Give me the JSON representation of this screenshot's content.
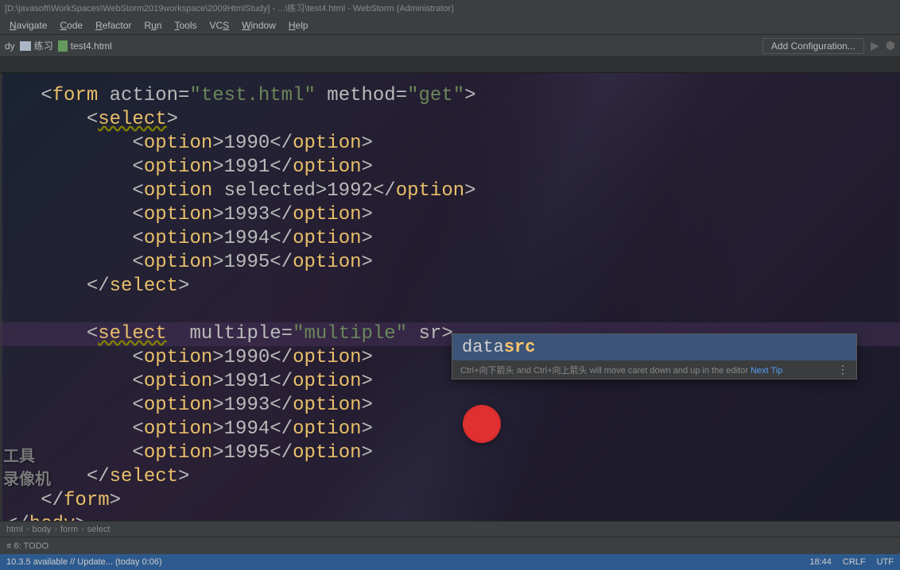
{
  "title_bar": "[D:\\javasoft\\WorkSpaces\\WebStorm2019workspace\\2009HtmlStudy] - ...\\练习\\test4.html - WebStorm (Administrator)",
  "menu": {
    "items": [
      "Navigate",
      "Code",
      "Refactor",
      "Run",
      "Tools",
      "VCS",
      "Window",
      "Help"
    ]
  },
  "nav": {
    "crumb1": "dy",
    "crumb2": "练习",
    "crumb3": "test4.html",
    "add_config": "Add Configuration..."
  },
  "code": {
    "lines": [
      {
        "indent": 1,
        "raw": "<form action=\"test.html\" method=\"get\">"
      },
      {
        "indent": 2,
        "raw": "<select>"
      },
      {
        "indent": 3,
        "raw": "<option>1990</option>"
      },
      {
        "indent": 3,
        "raw": "<option>1991</option>"
      },
      {
        "indent": 3,
        "raw": "<option selected>1992</option>"
      },
      {
        "indent": 3,
        "raw": "<option>1993</option>"
      },
      {
        "indent": 3,
        "raw": "<option>1994</option>"
      },
      {
        "indent": 3,
        "raw": "<option>1995</option>"
      },
      {
        "indent": 2,
        "raw": "</select>"
      },
      {
        "indent": 0,
        "raw": ""
      },
      {
        "indent": 2,
        "raw": "<select  multiple=\"multiple\" sr>"
      },
      {
        "indent": 3,
        "raw": "<option>1990</option>"
      },
      {
        "indent": 3,
        "raw": "<option>1991</option>"
      },
      {
        "indent": 3,
        "raw": "<option>1993</option>"
      },
      {
        "indent": 3,
        "raw": "<option>1994</option>"
      },
      {
        "indent": 3,
        "raw": "<option>1995</option>"
      },
      {
        "indent": 2,
        "raw": "</select>"
      },
      {
        "indent": 1,
        "raw": "</form>"
      },
      {
        "indent": 0,
        "raw": "</body>"
      }
    ]
  },
  "completion": {
    "item_prefix": "data",
    "item_match": "src",
    "hint_prefix": "Ctrl+向下箭头 and Ctrl+向上箭头 will move caret down and up in the editor",
    "hint_link": "Next Tip"
  },
  "watermark": {
    "line1": "工具",
    "line2": "录像机"
  },
  "breadcrumbs": [
    "html",
    "body",
    "form",
    "select"
  ],
  "bottom": {
    "todo": "6: TODO"
  },
  "status": {
    "left": "10.3.5 available // Update... (today 0:06)",
    "time": "18:44",
    "crlf": "CRLF",
    "enc": "UTF"
  }
}
